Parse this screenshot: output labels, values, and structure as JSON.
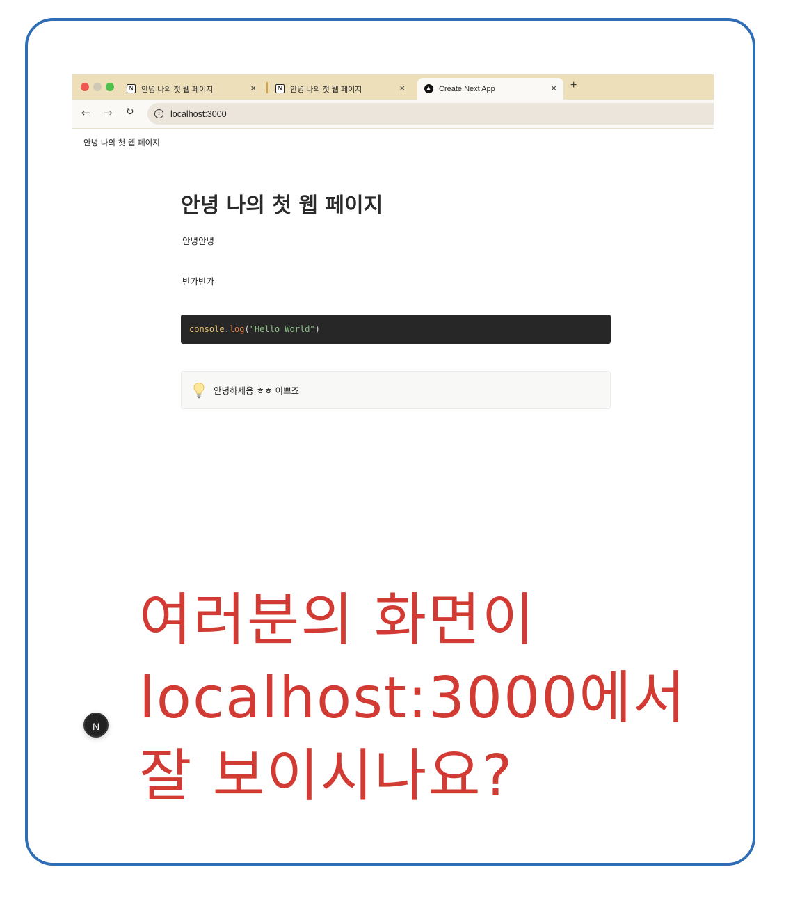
{
  "browser": {
    "tabs": [
      {
        "label": "안녕 나의 첫 웹 페이지",
        "icon": "notion-icon",
        "close": "×"
      },
      {
        "label": "안녕 나의 첫 웹 페이지",
        "icon": "notion-icon",
        "close": "×"
      },
      {
        "label": "Create Next App",
        "icon": "nextjs-icon",
        "close": "×",
        "active": true
      }
    ],
    "new_tab": "+",
    "nav": {
      "back": "←",
      "forward": "→",
      "reload": "↻"
    },
    "url": "localhost:3000"
  },
  "page": {
    "nav_title": "안녕 나의 첫 웹 페이지",
    "title": "안녕 나의 첫 웹 페이지",
    "paragraphs": [
      "안녕안녕",
      "반가반가"
    ],
    "code": {
      "object": "console",
      "dot": ".",
      "fn": "log",
      "open": "(",
      "string": "\"Hello World\"",
      "close": ")"
    },
    "callout": {
      "icon": "lightbulb-icon",
      "text": "안녕하세용 ㅎㅎ 이쁘죠"
    },
    "next_badge": "N"
  },
  "annotation": {
    "lines": [
      "여러분의 화면이",
      "localhost:3000에서",
      "잘 보이시나요?"
    ],
    "color": "#d13b34"
  },
  "colors": {
    "frame_border": "#2f6db5",
    "tabbar": "#ecdfb9",
    "code_bg": "#272727"
  }
}
